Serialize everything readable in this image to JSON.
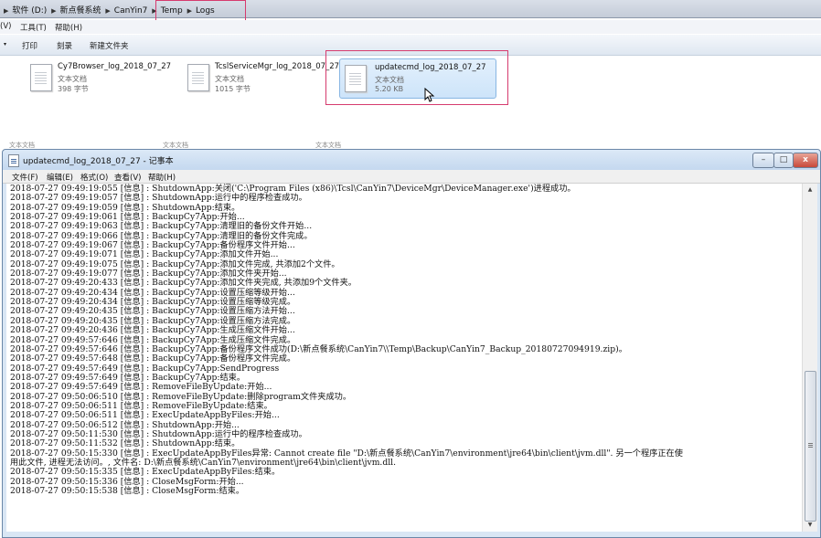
{
  "explorer": {
    "breadcrumb": [
      "软件 (D:)",
      "新点餐系统",
      "CanYin7",
      "Temp",
      "Logs"
    ],
    "menu": [
      "(V)",
      "工具(T)",
      "帮助(H)"
    ],
    "toolbar": [
      "打印",
      "刻录",
      "新建文件夹"
    ],
    "files": [
      {
        "name": "Cy7Browser_log_2018_07_27",
        "type": "文本文档",
        "size": "398 字节",
        "selected": false
      },
      {
        "name": "TcslServiceMgr_log_2018_07_27",
        "type": "文本文档",
        "size": "1015 字节",
        "selected": false
      },
      {
        "name": "updatecmd_log_2018_07_27",
        "type": "文本文档",
        "size": "5.20 KB",
        "selected": true
      }
    ],
    "ghost_labels": [
      "文本文档",
      "文本文档",
      "文本文档"
    ]
  },
  "notepad": {
    "title": "updatecmd_log_2018_07_27 - 记事本",
    "menu": [
      "文件(F)",
      "编辑(E)",
      "格式(O)",
      "查看(V)",
      "帮助(H)"
    ],
    "window_buttons": {
      "minimize": "–",
      "maximize": "□",
      "close": "x"
    },
    "content": "2018-07-27 09:49:19:055 [信息] : ShutdownApp:关闭('C:\\Program Files (x86)\\Tcsl\\CanYin7\\DeviceMgr\\DeviceManager.exe')进程成功。\n2018-07-27 09:49:19:057 [信息] : ShutdownApp:运行中的程序检查成功。\n2018-07-27 09:49:19:059 [信息] : ShutdownApp:结束。\n2018-07-27 09:49:19:061 [信息] : BackupCy7App:开始...\n2018-07-27 09:49:19:063 [信息] : BackupCy7App:清理旧的备份文件开始...\n2018-07-27 09:49:19:066 [信息] : BackupCy7App:清理旧的备份文件完成。\n2018-07-27 09:49:19:067 [信息] : BackupCy7App:备份程序文件开始...\n2018-07-27 09:49:19:071 [信息] : BackupCy7App:添加文件开始...\n2018-07-27 09:49:19:075 [信息] : BackupCy7App:添加文件完成, 共添加2个文件。\n2018-07-27 09:49:19:077 [信息] : BackupCy7App:添加文件夹开始...\n2018-07-27 09:49:20:433 [信息] : BackupCy7App:添加文件夹完成, 共添加9个文件夹。\n2018-07-27 09:49:20:434 [信息] : BackupCy7App:设置压缩等级开始...\n2018-07-27 09:49:20:434 [信息] : BackupCy7App:设置压缩等级完成。\n2018-07-27 09:49:20:435 [信息] : BackupCy7App:设置压缩方法开始...\n2018-07-27 09:49:20:435 [信息] : BackupCy7App:设置压缩方法完成。\n2018-07-27 09:49:20:436 [信息] : BackupCy7App:生成压缩文件开始...\n2018-07-27 09:49:57:646 [信息] : BackupCy7App:生成压缩文件完成。\n2018-07-27 09:49:57:646 [信息] : BackupCy7App:备份程序文件成功(D:\\新点餐系统\\CanYin7\\\\Temp\\Backup\\CanYin7_Backup_20180727094919.zip)。\n2018-07-27 09:49:57:648 [信息] : BackupCy7App:备份程序文件完成。\n2018-07-27 09:49:57:649 [信息] : BackupCy7App:SendProgress\n2018-07-27 09:49:57:649 [信息] : BackupCy7App:结束。\n2018-07-27 09:49:57:649 [信息] : RemoveFileByUpdate:开始...\n2018-07-27 09:50:06:510 [信息] : RemoveFileByUpdate:删除program文件夹成功。\n2018-07-27 09:50:06:511 [信息] : RemoveFileByUpdate:结束。\n2018-07-27 09:50:06:511 [信息] : ExecUpdateAppByFiles:开始...\n2018-07-27 09:50:06:512 [信息] : ShutdownApp:开始...\n2018-07-27 09:50:11:530 [信息] : ShutdownApp:运行中的程序检查成功。\n2018-07-27 09:50:11:532 [信息] : ShutdownApp:结束。\n2018-07-27 09:50:15:330 [信息] : ExecUpdateAppByFiles异常: Cannot create file \"D:\\新点餐系统\\CanYin7\\environment\\jre64\\bin\\client\\jvm.dll\". 另一个程序正在使\n用此文件, 进程无法访问。, 文件名: D:\\新点餐系统\\CanYin7\\environment\\jre64\\bin\\client\\jvm.dll.\n2018-07-27 09:50:15:335 [信息] : ExecUpdateAppByFiles:结束。\n2018-07-27 09:50:15:336 [信息] : CloseMsgForm:开始...\n2018-07-27 09:50:15:538 [信息] : CloseMsgForm:结束。"
  }
}
